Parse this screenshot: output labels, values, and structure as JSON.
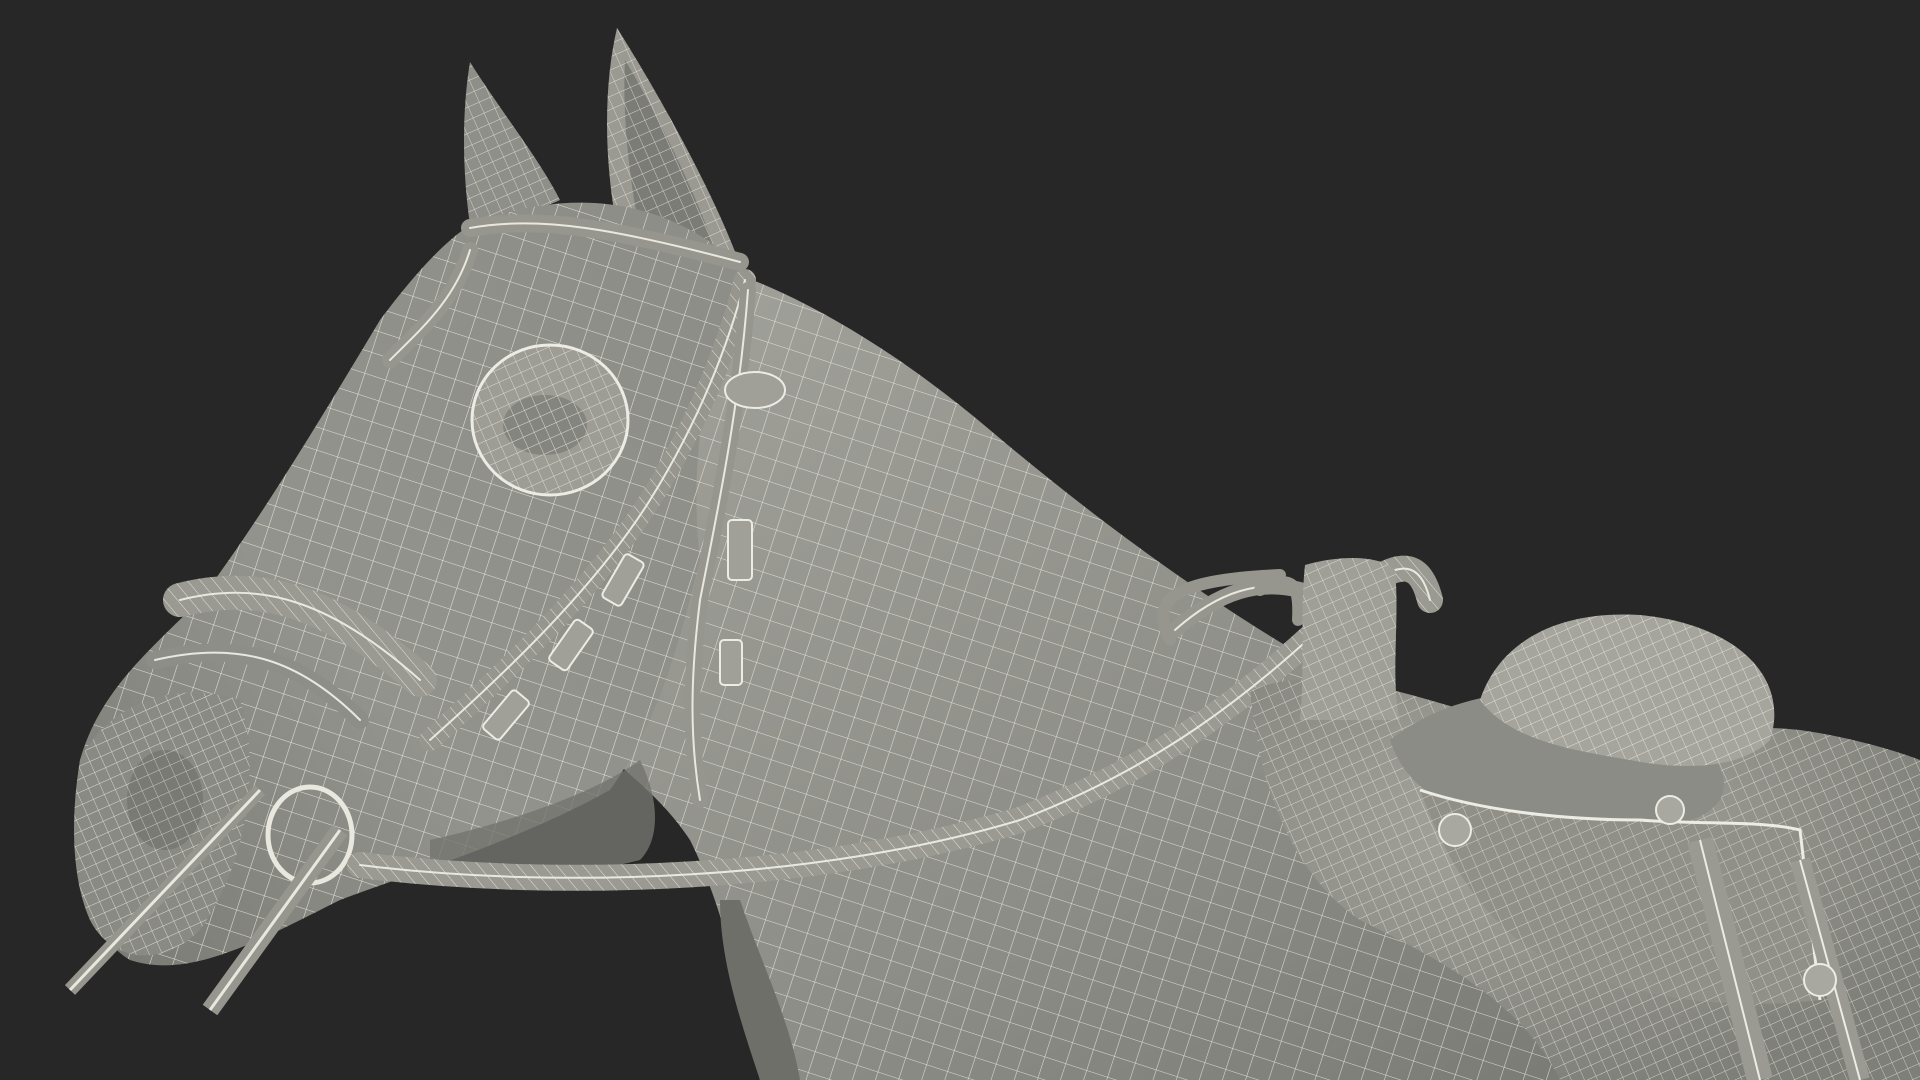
{
  "scene": {
    "subject": "horse-head-with-bridle-and-saddle-wireframe",
    "colors": {
      "background": "#272727",
      "surface": "#8e8e88",
      "surface_shadow": "#6f6f6a",
      "surface_light": "#a4a49d",
      "wire": "#ecece4",
      "strap": "#96968f",
      "strap_edge": "#e8e8df"
    }
  }
}
